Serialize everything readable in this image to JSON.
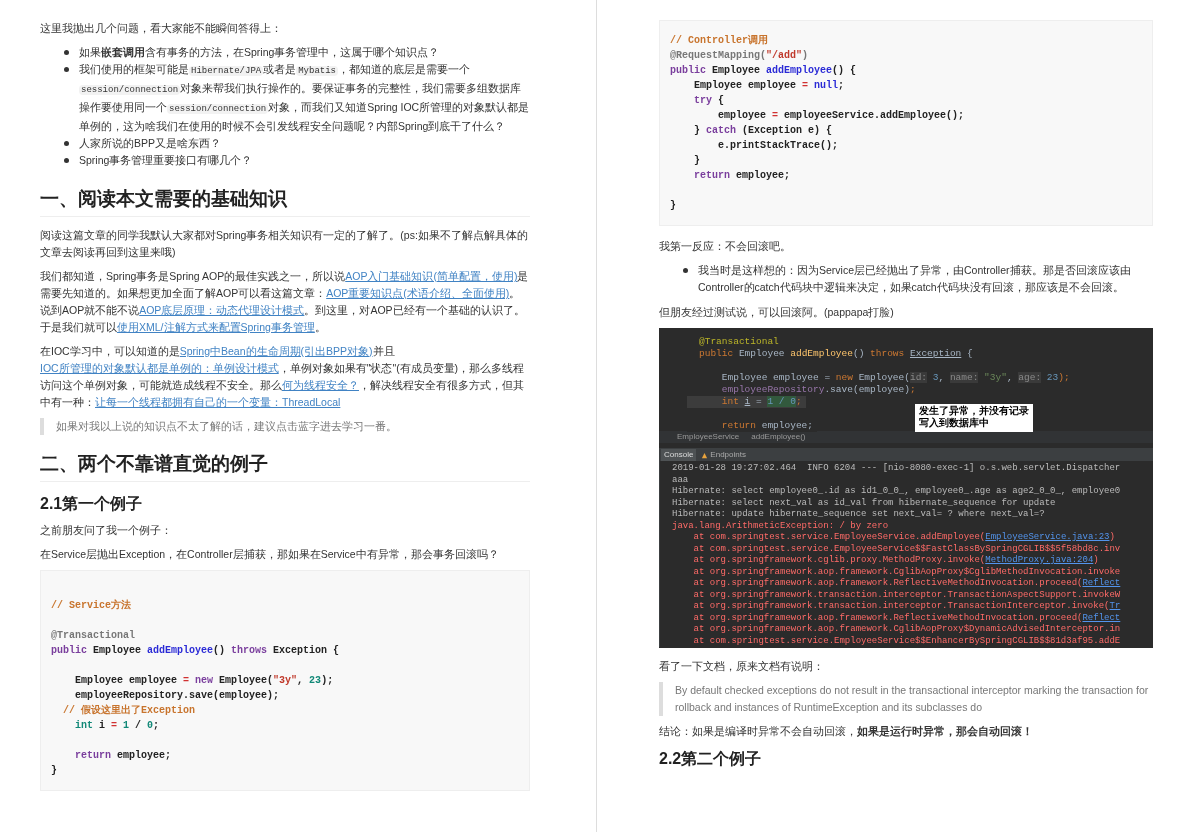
{
  "left_page": {
    "blocks": [
      {
        "kind": "paragraph",
        "segments": [
          {
            "kind": "text",
            "text": "这里我抛出几个问题，看大家能不能瞬间答得上："
          }
        ]
      },
      {
        "kind": "bullets",
        "items": [
          {
            "segments": [
              {
                "kind": "text",
                "text": "如果**嵌套调用**含有事务的方法，在Spring事务管理中，这属于哪个知识点？"
              }
            ]
          },
          {
            "segments": [
              {
                "kind": "text",
                "text": "我们使用的框架可能是"
              },
              {
                "kind": "code",
                "text": "Hibernate/JPA"
              },
              {
                "kind": "text",
                "text": "或者是"
              },
              {
                "kind": "code",
                "text": "Mybatis"
              },
              {
                "kind": "text",
                "text": "，都知道的底层是需要一个"
              },
              {
                "kind": "code",
                "text": "session/connection"
              },
              {
                "kind": "text",
                "text": "对象来帮我们执行操作的。要保证事务的完整性，我们需要多组数据库操作要使用同一个"
              },
              {
                "kind": "code",
                "text": "session/connection"
              },
              {
                "kind": "text",
                "text": "对象，而我们又知道Spring IOC所管理的对象默认都是单例的，这为啥我们在使用的时候不会引发线程安全问题呢？内部Spring到底干了什么？"
              }
            ]
          },
          {
            "segments": [
              {
                "kind": "text",
                "text": "人家所说的BPP又是啥东西？"
              }
            ]
          },
          {
            "segments": [
              {
                "kind": "text",
                "text": "Spring事务管理重要接口有哪几个？"
              }
            ]
          }
        ]
      },
      {
        "kind": "heading1",
        "text": "一、阅读本文需要的基础知识"
      },
      {
        "kind": "paragraph",
        "segments": [
          {
            "kind": "text",
            "text": "阅读这篇文章的同学我默认大家都对Spring事务相关知识有一定的了解了。(ps:如果不了解点解具体的文章去阅读再回到这里来哦)"
          }
        ]
      },
      {
        "kind": "paragraph",
        "segments": [
          {
            "kind": "text",
            "text": "我们都知道，Spring事务是Spring AOP的最佳实践之一，所以说"
          },
          {
            "kind": "link",
            "text": "AOP入门基础知识(简单配置，使用)"
          },
          {
            "kind": "text",
            "text": "是需要先知道的。如果想更加全面了解AOP可以看这篇文章："
          },
          {
            "kind": "link",
            "text": "AOP重要知识点(术语介绍、全面使用)"
          },
          {
            "kind": "text",
            "text": "。说到AOP就不能不说"
          },
          {
            "kind": "link",
            "text": "AOP底层原理：动态代理设计模式"
          },
          {
            "kind": "text",
            "text": "。到这里，对AOP已经有一个基础的认识了。于是我们就可以"
          },
          {
            "kind": "link",
            "text": "使用XML/注解方式来配置Spring事务管理"
          },
          {
            "kind": "text",
            "text": "。"
          }
        ]
      },
      {
        "kind": "paragraph",
        "segments": [
          {
            "kind": "text",
            "text": "在IOC学习中，可以知道的是"
          },
          {
            "kind": "link",
            "text": "Spring中Bean的生命周期(引出BPP对象)"
          },
          {
            "kind": "text",
            "text": "并且"
          },
          {
            "kind": "link",
            "text": "IOC所管理的对象默认都是单例的：单例设计模式"
          },
          {
            "kind": "text",
            "text": "，单例对象如果有\"状态\"(有成员变量)，那么多线程访问这个单例对象，可能就造成线程不安全。那么"
          },
          {
            "kind": "link",
            "text": "何为线程安全？"
          },
          {
            "kind": "text",
            "text": "，解决线程安全有很多方式，但其中有一种："
          },
          {
            "kind": "link",
            "text": "让每一个线程都拥有自己的一个变量：ThreadLocal"
          }
        ]
      },
      {
        "kind": "quote",
        "text": "如果对我以上说的知识点不太了解的话，建议点击蓝字进去学习一番。"
      },
      {
        "kind": "heading1",
        "text": "二、两个不靠谱直觉的例子"
      },
      {
        "kind": "heading2",
        "text": "2.1第一个例子"
      },
      {
        "kind": "paragraph",
        "segments": [
          {
            "kind": "text",
            "text": "之前朋友问了我一个例子："
          }
        ]
      },
      {
        "kind": "paragraph",
        "segments": [
          {
            "kind": "text",
            "text": "在Service层抛出Exception，在Controller层捕获，那如果在Service中有异常，那会事务回滚吗？"
          }
        ]
      },
      {
        "kind": "code",
        "lines": [
          {
            "space_before": true,
            "tokens": [
              {
                "kind": "comment",
                "text": "// Service方法"
              }
            ]
          },
          {
            "space_before": true,
            "tokens": [
              {
                "kind": "annotation",
                "text": "@Transactional"
              }
            ]
          },
          {
            "space_before": false,
            "tokens": [
              {
                "kind": "keyword",
                "text": "public"
              },
              {
                "kind": "plain",
                "text": " Employee "
              },
              {
                "kind": "method",
                "text": "addEmployee"
              },
              {
                "kind": "plain",
                "text": "() "
              },
              {
                "kind": "keyword",
                "text": "throws"
              },
              {
                "kind": "plain",
                "text": " Exception {"
              }
            ]
          },
          {
            "space_before": true,
            "tokens": [
              {
                "kind": "plain",
                "text": "    Employee employee "
              },
              {
                "kind": "operator",
                "text": "="
              },
              {
                "kind": "keyword",
                "text": " new"
              },
              {
                "kind": "plain",
                "text": " Employee("
              },
              {
                "kind": "string",
                "text": "\"3y\""
              },
              {
                "kind": "plain",
                "text": ", "
              },
              {
                "kind": "number",
                "text": "23"
              },
              {
                "kind": "plain",
                "text": ");"
              }
            ]
          },
          {
            "space_before": false,
            "tokens": [
              {
                "kind": "plain",
                "text": "    employeeRepository.save(employee);"
              }
            ]
          },
          {
            "space_before": false,
            "tokens": [
              {
                "kind": "comment",
                "text": "  // 假设这里出了Exception"
              }
            ]
          },
          {
            "space_before": false,
            "tokens": [
              {
                "kind": "type",
                "text": "    int"
              },
              {
                "kind": "plain",
                "text": " i "
              },
              {
                "kind": "operator",
                "text": "="
              },
              {
                "kind": "number",
                "text": " 1"
              },
              {
                "kind": "plain",
                "text": " / "
              },
              {
                "kind": "number",
                "text": "0"
              },
              {
                "kind": "plain",
                "text": ";"
              }
            ]
          },
          {
            "space_before": true,
            "tokens": [
              {
                "kind": "keyword",
                "text": "    return"
              },
              {
                "kind": "plain",
                "text": " employee;"
              }
            ]
          },
          {
            "space_before": false,
            "tokens": [
              {
                "kind": "plain",
                "text": "}"
              }
            ]
          }
        ]
      }
    ]
  },
  "right_page": {
    "blocks": [
      {
        "kind": "code",
        "lines": [
          {
            "space_before": false,
            "tokens": [
              {
                "kind": "comment",
                "text": "// Controller调用"
              }
            ]
          },
          {
            "space_before": false,
            "tokens": [
              {
                "kind": "annotation",
                "text": "@RequestMapping("
              },
              {
                "kind": "string",
                "text": "\"/add\""
              },
              {
                "kind": "annotation",
                "text": ")"
              }
            ]
          },
          {
            "space_before": false,
            "tokens": [
              {
                "kind": "keyword",
                "text": "public"
              },
              {
                "kind": "plain",
                "text": " Employee "
              },
              {
                "kind": "method",
                "text": "addEmployee"
              },
              {
                "kind": "plain",
                "text": "() {"
              }
            ]
          },
          {
            "space_before": false,
            "tokens": [
              {
                "kind": "plain",
                "text": "    Employee employee "
              },
              {
                "kind": "operator",
                "text": "="
              },
              {
                "kind": "literal",
                "text": " null"
              },
              {
                "kind": "plain",
                "text": ";"
              }
            ]
          },
          {
            "space_before": false,
            "tokens": [
              {
                "kind": "keyword",
                "text": "    try"
              },
              {
                "kind": "plain",
                "text": " {"
              }
            ]
          },
          {
            "space_before": false,
            "tokens": [
              {
                "kind": "plain",
                "text": "        employee "
              },
              {
                "kind": "operator",
                "text": "="
              },
              {
                "kind": "plain",
                "text": " employeeService.addEmployee();"
              }
            ]
          },
          {
            "space_before": false,
            "tokens": [
              {
                "kind": "plain",
                "text": "    } "
              },
              {
                "kind": "keyword",
                "text": "catch"
              },
              {
                "kind": "plain",
                "text": " (Exception e) {"
              }
            ]
          },
          {
            "space_before": false,
            "tokens": [
              {
                "kind": "plain",
                "text": "        e.printStackTrace();"
              }
            ]
          },
          {
            "space_before": false,
            "tokens": [
              {
                "kind": "plain",
                "text": "    }"
              }
            ]
          },
          {
            "space_before": false,
            "tokens": [
              {
                "kind": "keyword",
                "text": "    return"
              },
              {
                "kind": "plain",
                "text": " employee;"
              }
            ]
          },
          {
            "space_before": true,
            "tokens": [
              {
                "kind": "plain",
                "text": "}"
              }
            ]
          }
        ]
      },
      {
        "kind": "paragraph",
        "segments": [
          {
            "kind": "text",
            "text": "我第一反应：不会回滚吧。"
          }
        ]
      },
      {
        "kind": "bullets",
        "items": [
          {
            "segments": [
              {
                "kind": "text",
                "text": "我当时是这样想的：因为Service层已经抛出了异常，由Controller捕获。那是否回滚应该由Controller的catch代码块中逻辑来决定，如果catch代码块没有回滚，那应该是不会回滚。"
              }
            ]
          }
        ]
      },
      {
        "kind": "paragraph",
        "segments": [
          {
            "kind": "text",
            "text": "但朋友经过测试说，可以回滚阿。(pappapa打脸)"
          }
        ]
      },
      {
        "kind": "ide_screenshot",
        "editor_lines": [
          {
            "highlighted": false,
            "space_before": false,
            "tokens": [
              {
                "kind": "annotation",
                "text": "@Transactional"
              }
            ]
          },
          {
            "highlighted": false,
            "space_before": false,
            "tokens": [
              {
                "kind": "keyword",
                "text": "public"
              },
              {
                "kind": "plain",
                "text": " Employee "
              },
              {
                "kind": "method",
                "text": "addEmployee"
              },
              {
                "kind": "plain",
                "text": "() "
              },
              {
                "kind": "keyword",
                "text": "throws "
              },
              {
                "kind": "underline",
                "text": "Exception"
              },
              {
                "kind": "plain",
                "text": " {"
              }
            ]
          },
          {
            "highlighted": false,
            "space_before": true,
            "tokens": [
              {
                "kind": "plain",
                "text": "    Employee employee = "
              },
              {
                "kind": "keyword",
                "text": "new"
              },
              {
                "kind": "plain",
                "text": " Employee("
              },
              {
                "kind": "hint",
                "text": "id:"
              },
              {
                "kind": "number",
                "text": " 3"
              },
              {
                "kind": "plain",
                "text": ", "
              },
              {
                "kind": "hint",
                "text": "name:"
              },
              {
                "kind": "string",
                "text": " \"3y\""
              },
              {
                "kind": "plain",
                "text": ", "
              },
              {
                "kind": "hint",
                "text": "age:"
              },
              {
                "kind": "number",
                "text": " 23"
              },
              {
                "kind": "keyword",
                "text": ");"
              }
            ]
          },
          {
            "highlighted": false,
            "space_before": false,
            "tokens": [
              {
                "kind": "field",
                "text": "    employeeRepository"
              },
              {
                "kind": "plain",
                "text": ".save(employee)"
              },
              {
                "kind": "keyword",
                "text": ";"
              }
            ]
          },
          {
            "highlighted": true,
            "space_before": false,
            "tokens": [
              {
                "kind": "keyword",
                "text": "    int "
              },
              {
                "kind": "underline",
                "text": "i"
              },
              {
                "kind": "plain",
                "text": " = "
              },
              {
                "kind": "highlight",
                "text": "1 / 0"
              },
              {
                "kind": "keyword",
                "text": ";"
              }
            ]
          },
          {
            "highlighted": false,
            "space_before": true,
            "tokens": [
              {
                "kind": "keyword",
                "text": "    return"
              },
              {
                "kind": "plain",
                "text": " employee;"
              }
            ]
          }
        ],
        "callout": [
          "发生了异常，并没有记录",
          "写入到数据库中"
        ],
        "breadcrumbs": [
          "EmployeeService",
          "addEmployee()"
        ],
        "tabs": [
          {
            "label": "Console",
            "selected": true
          },
          {
            "label": "Endpoints",
            "selected": false
          }
        ],
        "console_lines": [
          {
            "kind": "plain",
            "segments": [
              {
                "kind": "plain",
                "text": "2019-01-28 19:27:02.464  INFO 6204 --- [nio-8080-exec-1] o.s.web.servlet.Dispatcher"
              }
            ]
          },
          {
            "kind": "plain",
            "segments": [
              {
                "kind": "plain",
                "text": "aaa"
              }
            ]
          },
          {
            "kind": "plain",
            "segments": [
              {
                "kind": "plain",
                "text": "Hibernate: select employee0_.id as id1_0_0_, employee0_.age as age2_0_0_, employee0"
              }
            ]
          },
          {
            "kind": "plain",
            "segments": [
              {
                "kind": "plain",
                "text": "Hibernate: select next_val as id_val from hibernate_sequence for update"
              }
            ]
          },
          {
            "kind": "plain",
            "segments": [
              {
                "kind": "plain",
                "text": "Hibernate: update hibernate_sequence set next_val= ? where next_val=?"
              }
            ]
          },
          {
            "kind": "error",
            "segments": [
              {
                "kind": "plain",
                "text": "java.lang.ArithmeticException: / by zero"
              }
            ]
          },
          {
            "kind": "error",
            "segments": [
              {
                "kind": "plain",
                "text": "    at com.springtest.service.EmployeeService.addEmployee("
              },
              {
                "kind": "link",
                "text": "EmployeeService.java:23"
              },
              {
                "kind": "plain",
                "text": ")"
              }
            ]
          },
          {
            "kind": "error",
            "segments": [
              {
                "kind": "plain",
                "text": "    at com.springtest.service.EmployeeService$$FastClassBySpringCGLIB$$5f58bd8c.inv"
              }
            ]
          },
          {
            "kind": "error",
            "segments": [
              {
                "kind": "plain",
                "text": "    at org.springframework.cglib.proxy.MethodProxy.invoke("
              },
              {
                "kind": "link",
                "text": "MethodProxy.java:204"
              },
              {
                "kind": "plain",
                "text": ")"
              }
            ]
          },
          {
            "kind": "error",
            "segments": [
              {
                "kind": "plain",
                "text": "    at org.springframework.aop.framework.CglibAopProxy$CglibMethodInvocation.invoke"
              }
            ]
          },
          {
            "kind": "error",
            "segments": [
              {
                "kind": "plain",
                "text": "    at org.springframework.aop.framework.ReflectiveMethodInvocation.proceed("
              },
              {
                "kind": "link",
                "text": "Reflect"
              }
            ]
          },
          {
            "kind": "error",
            "segments": [
              {
                "kind": "plain",
                "text": "    at org.springframework.transaction.interceptor.TransactionAspectSupport.invokeW"
              }
            ]
          },
          {
            "kind": "error",
            "segments": [
              {
                "kind": "plain",
                "text": "    at org.springframework.transaction.interceptor.TransactionInterceptor.invoke("
              },
              {
                "kind": "link",
                "text": "Tr"
              }
            ]
          },
          {
            "kind": "error",
            "segments": [
              {
                "kind": "plain",
                "text": "    at org.springframework.aop.framework.ReflectiveMethodInvocation.proceed("
              },
              {
                "kind": "link",
                "text": "Reflect"
              }
            ]
          },
          {
            "kind": "error",
            "segments": [
              {
                "kind": "plain",
                "text": "    at org.springframework.aop.framework.CglibAopProxy$DynamicAdvisedInterceptor.in"
              }
            ]
          },
          {
            "kind": "error",
            "segments": [
              {
                "kind": "plain",
                "text": "    at com.springtest.service.EmployeeService$$EnhancerBySpringCGLIB$$81d3af95.addE"
              }
            ]
          }
        ]
      },
      {
        "kind": "paragraph",
        "segments": [
          {
            "kind": "text",
            "text": "看了一下文档，原来文档有说明："
          }
        ]
      },
      {
        "kind": "quote",
        "text": "By default checked exceptions do not result in the transactional interceptor marking the transaction for rollback and instances of RuntimeException and its  subclasses do"
      },
      {
        "kind": "paragraph",
        "segments": [
          {
            "kind": "text",
            "text": "结论：如果是编译时异常不会自动回滚，**如果是运行时异常，那会自动回滚！**"
          }
        ]
      },
      {
        "kind": "heading2",
        "text": "2.2第二个例子"
      }
    ]
  }
}
